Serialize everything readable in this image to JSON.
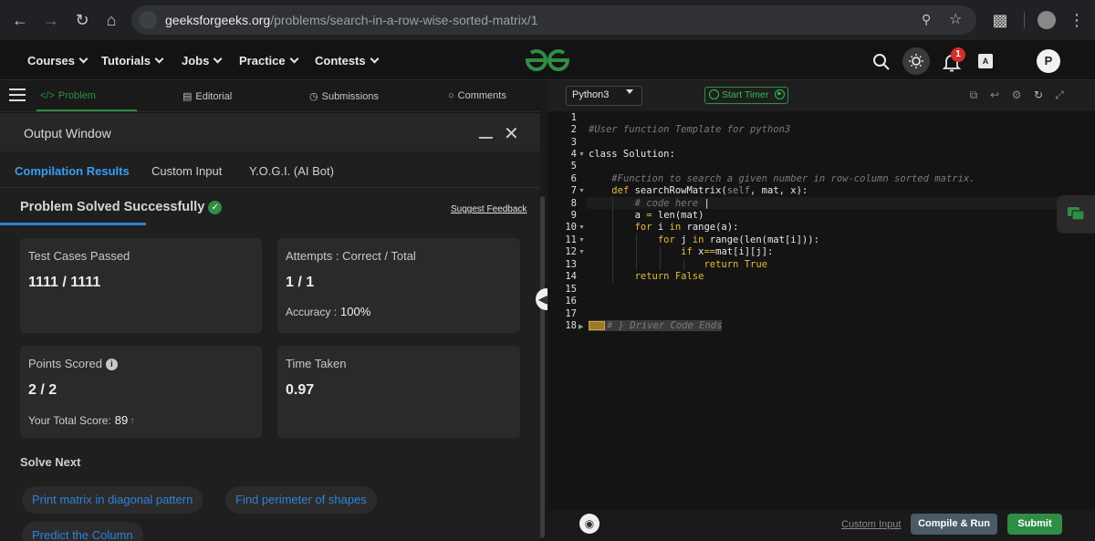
{
  "browser": {
    "url_host": "geeksforgeeks.org",
    "url_path": "/problems/search-in-a-row-wise-sorted-matrix/1"
  },
  "site_nav": {
    "items": [
      "Courses",
      "Tutorials",
      "Jobs",
      "Practice",
      "Contests"
    ],
    "notification_count": "1",
    "avatar_letter": "P"
  },
  "problem_tabs": {
    "problem": "Problem",
    "editorial": "Editorial",
    "submissions": "Submissions",
    "comments": "Comments"
  },
  "output_window": {
    "title": "Output Window",
    "tabs": [
      "Compilation Results",
      "Custom Input",
      "Y.O.G.I. (AI Bot)"
    ],
    "status": "Problem Solved Successfully",
    "feedback_link": "Suggest Feedback",
    "cards": {
      "test_cases_label": "Test Cases Passed",
      "test_cases_value": "1111 / 1111",
      "attempts_label": "Attempts : Correct / Total",
      "attempts_value": "1 / 1",
      "accuracy_label": "Accuracy :",
      "accuracy_value": "100%",
      "points_label": "Points Scored",
      "points_value": "2 / 2",
      "total_score_label": "Your Total Score:",
      "total_score_value": "89",
      "time_label": "Time Taken",
      "time_value": "0.97"
    },
    "solve_next_title": "Solve Next",
    "solve_next": [
      "Print matrix in diagonal pattern",
      "Find perimeter of shapes",
      "Predict the Column"
    ]
  },
  "editor": {
    "language": "Python3",
    "timer_label": "Start Timer",
    "line_numbers": [
      "1",
      "2",
      "3",
      "4",
      "5",
      "6",
      "7",
      "8",
      "9",
      "10",
      "11",
      "12",
      "13",
      "14",
      "15",
      "16",
      "17",
      "18"
    ],
    "custom_input_link": "Custom Input",
    "compile_button": "Compile & Run",
    "submit_button": "Submit"
  },
  "colors": {
    "accent_green": "#2f8d46",
    "link_blue": "#2f82d8",
    "keyword_yellow": "#e9b93b"
  }
}
